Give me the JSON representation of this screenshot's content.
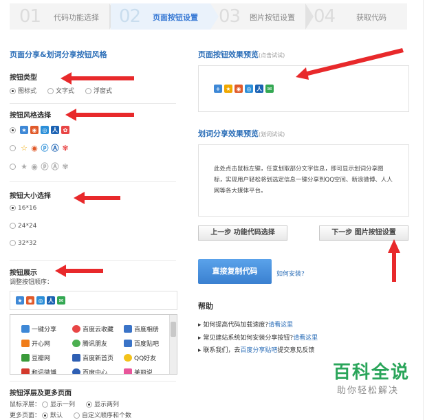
{
  "steps": [
    {
      "num": "01",
      "label": "代码功能选择"
    },
    {
      "num": "02",
      "label": "页面按钮设置"
    },
    {
      "num": "03",
      "label": "图片按钮设置"
    },
    {
      "num": "04",
      "label": "获取代码"
    }
  ],
  "left": {
    "section_title": "页面分享&划词分享按钮风格",
    "button_type": {
      "title": "按钮类型",
      "options": [
        "图标式",
        "文字式",
        "浮窗式"
      ],
      "selected": "图标式"
    },
    "button_style": {
      "title": "按钮风格选择"
    },
    "button_size": {
      "title": "按钮大小选择",
      "options": [
        "16*16",
        "24*24",
        "32*32"
      ],
      "selected": "16*16"
    },
    "button_display": {
      "title": "按钮展示",
      "subtitle": "调整按钮顺序：",
      "services": [
        [
          "一键分享",
          "百度云收藏",
          "百度相册"
        ],
        [
          "开心网",
          "腾讯朋友",
          "百度贴吧"
        ],
        [
          "豆瓣网",
          "百度新首页",
          "QQ好友"
        ],
        [
          "和讯微博",
          "百度中心",
          "美丽说"
        ]
      ]
    },
    "float_layer": {
      "title": "按钮浮层及更多页面",
      "hover_label": "鼠标浮层：",
      "hover_options": [
        "显示一列",
        "显示两列"
      ],
      "hover_selected": "显示两列",
      "more_label": "更多页面：",
      "more_options": [
        "默认",
        "自定义顺序和个数"
      ],
      "more_selected": "默认"
    }
  },
  "right": {
    "preview_title": "页面按钮效果预览",
    "preview_hint": "(点击试试)",
    "select_title": "划词分享效果预览",
    "select_hint": "(划词试试)",
    "select_text": "此处点击鼠标左键，任意划取部分文字信息，即可显示划词分享图标，实现用户轻松将划选定信息一键分享到QQ空间、新浪微博、人人网等各大媒体平台。",
    "prev_button": "上一步 功能代码选择",
    "next_button": "下一步 图片按钮设置",
    "copy_button": "直接复制代码",
    "install_link": "如何安装?",
    "help_title": "帮助",
    "help_items": [
      {
        "text": "如何提高代码加载速度?",
        "link": "请看这里"
      },
      {
        "text": "常见建站系统如何安装分享按钮?",
        "link": "请看这里"
      },
      {
        "text_before": "联系我们，去",
        "link": "百度分享贴吧",
        "text_after": "提交意见反馈"
      }
    ]
  },
  "watermark": {
    "big": "百科全说",
    "small": "助你轻松解决"
  },
  "colors": {
    "accent_blue": "#2d6fb8",
    "arrow_red": "#e8292b",
    "watermark_green": "#2aa55a"
  }
}
